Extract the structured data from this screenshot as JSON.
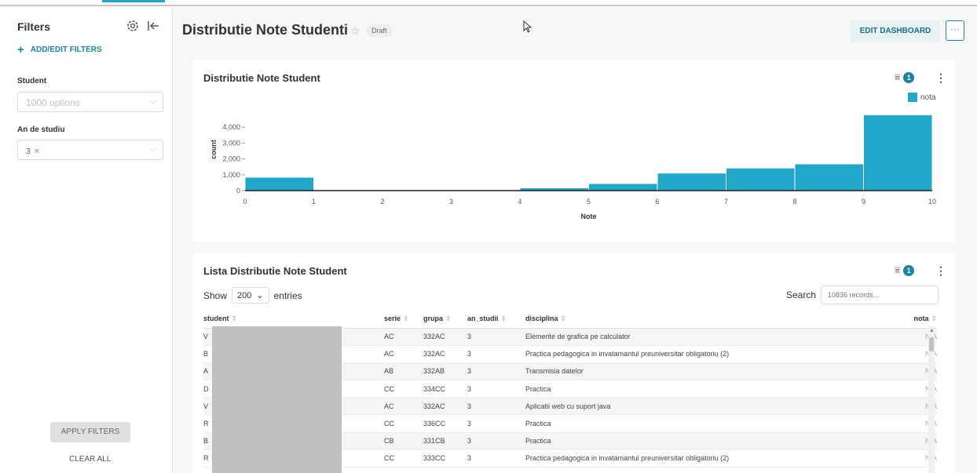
{
  "sidebar": {
    "title": "Filters",
    "add_filters": "ADD/EDIT FILTERS",
    "filters": [
      {
        "label": "Student",
        "placeholder": "1000 options"
      },
      {
        "label": "An de studiu",
        "value": "3"
      }
    ],
    "apply": "APPLY FILTERS",
    "clear": "CLEAR ALL"
  },
  "header": {
    "title": "Distributie Note Studenti",
    "badge": "Draft",
    "edit": "EDIT DASHBOARD",
    "more": "···"
  },
  "chart_panel": {
    "title": "Distributie Note Student",
    "filter_count": "1"
  },
  "chart_data": {
    "type": "bar",
    "title": "Distributie Note Student",
    "xlabel": "Note",
    "ylabel": "count",
    "bins": [
      0,
      1,
      2,
      3,
      4,
      5,
      6,
      7,
      8,
      9
    ],
    "values": [
      820,
      0,
      0,
      0,
      150,
      420,
      1080,
      1400,
      1660,
      4760
    ],
    "xlim": [
      0,
      10
    ],
    "ylim": [
      0,
      5000
    ],
    "yticks": [
      0,
      1000,
      2000,
      3000,
      4000
    ],
    "ytick_labels": [
      "0",
      "1,000",
      "2,000",
      "3,000",
      "4,000"
    ],
    "xticks": [
      "0",
      "1",
      "2",
      "3",
      "4",
      "5",
      "6",
      "7",
      "8",
      "9",
      "10"
    ],
    "legend": [
      "nota"
    ],
    "legend_position": "top-right",
    "color": "#20a7c9"
  },
  "table_panel": {
    "title": "Lista Distributie Note Student",
    "filter_count": "1",
    "show_label": "Show",
    "entries_value": "200",
    "entries_label": "entries",
    "search_label": "Search",
    "search_placeholder": "10836 records...",
    "columns": [
      "student",
      "serie",
      "grupa",
      "an_studii",
      "disciplina",
      "nota"
    ],
    "rows": [
      {
        "student": "V",
        "serie": "AC",
        "grupa": "332AC",
        "an": "3",
        "disciplina": "Elemente de grafica pe calculator",
        "nota": "N/A"
      },
      {
        "student": "B",
        "serie": "AC",
        "grupa": "332AC",
        "an": "3",
        "disciplina": "Practica pedagogica in invatamantul preuniversitar obligatoriu (2)",
        "nota": "N/A"
      },
      {
        "student": "A",
        "serie": "AB",
        "grupa": "332AB",
        "an": "3",
        "disciplina": "Transmisia datelor",
        "nota": "N/A"
      },
      {
        "student": "D",
        "serie": "CC",
        "grupa": "334CC",
        "an": "3",
        "disciplina": "Practica",
        "nota": "N/A"
      },
      {
        "student": "V",
        "serie": "AC",
        "grupa": "332AC",
        "an": "3",
        "disciplina": "Aplicatii web cu suport java",
        "nota": "N/A"
      },
      {
        "student": "R",
        "serie": "CC",
        "grupa": "336CC",
        "an": "3",
        "disciplina": "Practica",
        "nota": "N/A"
      },
      {
        "student": "B",
        "serie": "CB",
        "grupa": "331CB",
        "an": "3",
        "disciplina": "Practica",
        "nota": "N/A"
      },
      {
        "student": "R",
        "serie": "CC",
        "grupa": "333CC",
        "an": "3",
        "disciplina": "Practica pedagogica in invatamantul preuniversitar obligatoriu (2)",
        "nota": "N/A"
      }
    ]
  }
}
